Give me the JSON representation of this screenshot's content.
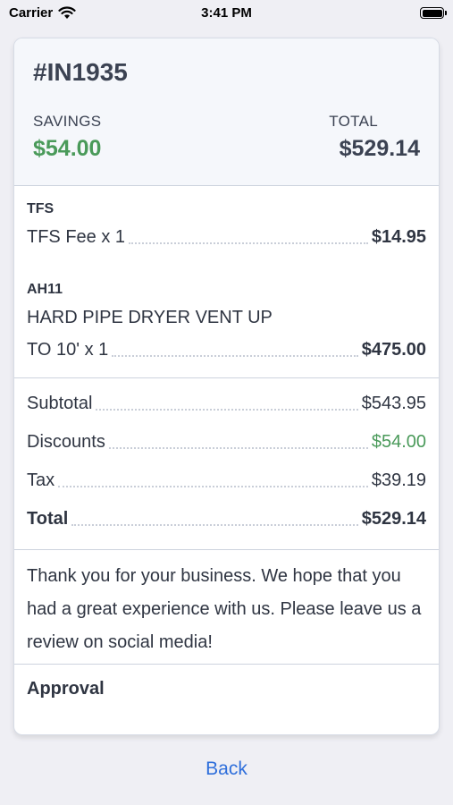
{
  "status_bar": {
    "carrier": "Carrier",
    "time": "3:41 PM"
  },
  "invoice": {
    "id": "#IN1935",
    "savings_label": "SAVINGS",
    "savings_value": "$54.00",
    "total_label": "TOTAL",
    "total_value": "$529.14"
  },
  "items": [
    {
      "code": "TFS",
      "description": "TFS Fee x 1",
      "amount": "$14.95"
    },
    {
      "code": "AH11",
      "description_line1": "HARD PIPE DRYER VENT UP",
      "description_line2": "TO 10' x 1",
      "amount": "$475.00"
    }
  ],
  "summary": {
    "subtotal_label": "Subtotal",
    "subtotal_value": "$543.95",
    "discounts_label": "Discounts",
    "discounts_value": "$54.00",
    "tax_label": "Tax",
    "tax_value": "$39.19",
    "total_label": "Total",
    "total_value": "$529.14"
  },
  "message": "Thank you for your business. We hope that you had a great experience with us. Please leave us a review on social media!",
  "approval_label": "Approval",
  "back_label": "Back",
  "colors": {
    "accent_green": "#4a9a5a",
    "link_blue": "#2f6fdb"
  }
}
